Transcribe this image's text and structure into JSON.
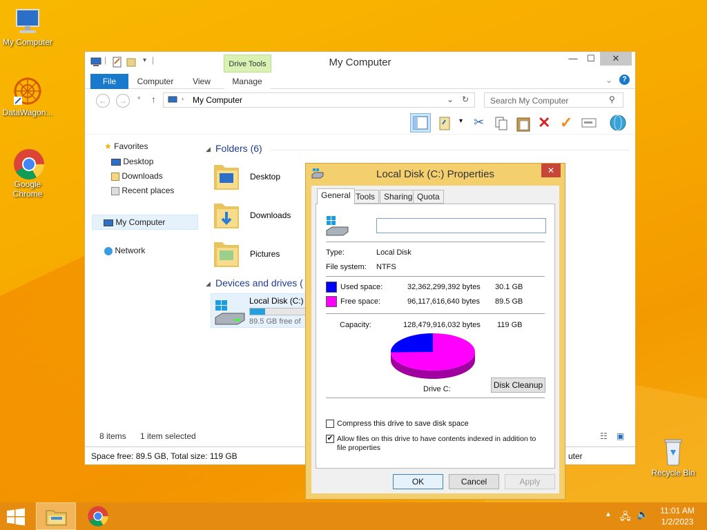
{
  "desktop": {
    "icons": [
      {
        "label": "My Computer"
      },
      {
        "label": "DataWagon..."
      },
      {
        "label": "Google Chrome"
      },
      {
        "label": "Recycle Bin"
      }
    ]
  },
  "explorer": {
    "title": "My Computer",
    "ribbon": {
      "contextual_group": "Drive Tools",
      "tabs": [
        "File",
        "Computer",
        "View",
        "Manage"
      ]
    },
    "address": "My Computer",
    "search_placeholder": "Search My Computer",
    "nav": {
      "favorites": "Favorites",
      "favorites_items": [
        "Desktop",
        "Downloads",
        "Recent places"
      ],
      "computer": "My Computer",
      "network": "Network"
    },
    "folders_header": "Folders (6)",
    "folders": [
      "Desktop",
      "Downloads",
      "Pictures"
    ],
    "devices_header": "Devices and drives (",
    "drive": {
      "name": "Local Disk (C:)",
      "free_text": "89.5 GB free of",
      "used_fraction": 0.25
    },
    "status_items": "8 items",
    "status_selected": "1 item selected",
    "details_bar": "Space free: 89.5 GB, Total size: 119 GB",
    "details_bar_right": "uter"
  },
  "dialog": {
    "title": "Local Disk (C:) Properties",
    "tabs": [
      "General",
      "Tools",
      "Sharing",
      "Quota"
    ],
    "label_value": "",
    "type_label": "Type:",
    "type_value": "Local Disk",
    "fs_label": "File system:",
    "fs_value": "NTFS",
    "used_label": "Used space:",
    "used_bytes": "32,362,299,392 bytes",
    "used_gb": "30.1 GB",
    "free_label": "Free space:",
    "free_bytes": "96,117,616,640 bytes",
    "free_gb": "89.5 GB",
    "capacity_label": "Capacity:",
    "capacity_bytes": "128,479,916,032 bytes",
    "capacity_gb": "119 GB",
    "drive_label": "Drive C:",
    "cleanup": "Disk Cleanup",
    "compress": "Compress this drive to save disk space",
    "compress_checked": false,
    "index_line1": "Allow files on this drive to have contents indexed in addition to",
    "index_line2": "file properties",
    "index_checked": true,
    "ok": "OK",
    "cancel": "Cancel",
    "apply": "Apply",
    "colors": {
      "used": "#0000ff",
      "free": "#ff00ff"
    }
  },
  "taskbar": {
    "time": "11:01 AM",
    "date": "1/2/2023"
  }
}
